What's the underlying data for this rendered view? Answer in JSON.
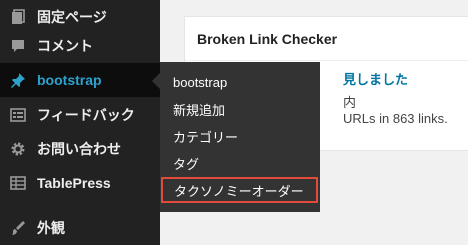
{
  "sidebar": {
    "items": [
      {
        "label": "固定ページ",
        "icon": "pages-icon"
      },
      {
        "label": "コメント",
        "icon": "comments-icon"
      },
      {
        "label": "bootstrap",
        "icon": "pin-icon",
        "current": true
      },
      {
        "label": "フィードバック",
        "icon": "feedback-icon"
      },
      {
        "label": "お問い合わせ",
        "icon": "gear-icon"
      },
      {
        "label": "TablePress",
        "icon": "table-icon"
      },
      {
        "label": "外観",
        "icon": "appearance-icon"
      }
    ]
  },
  "submenu": {
    "items": [
      {
        "label": "bootstrap"
      },
      {
        "label": "新規追加"
      },
      {
        "label": "カテゴリー"
      },
      {
        "label": "タグ"
      },
      {
        "label": "タクソノミーオーダー",
        "highlighted": true
      }
    ],
    "highlight_color": "#e24b3b"
  },
  "widget": {
    "title": "Broken Link Checker",
    "link_fragment": "見しました",
    "line2_fragment": "内",
    "line3_fragment": "URLs in 863 links."
  },
  "colors": {
    "sidebar_bg": "#222222",
    "submenu_bg": "#333333",
    "accent": "#2ea2cc",
    "link": "#0074a2"
  }
}
